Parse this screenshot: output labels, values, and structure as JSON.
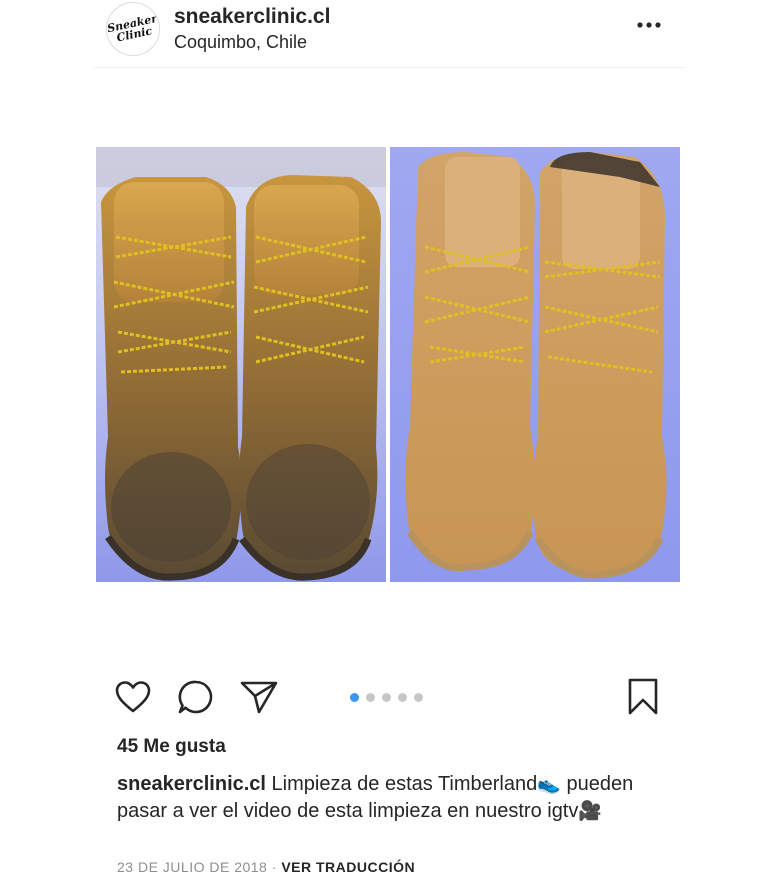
{
  "header": {
    "avatar_text_line1": "Sneaker",
    "avatar_text_line2": "Clinic",
    "username": "sneakerclinic.cl",
    "location": "Coquimbo, Chile",
    "more_icon": "more-horizontal-icon"
  },
  "post": {
    "photo_left_alt": "Timberland boots before cleaning",
    "photo_right_alt": "Timberland boots after cleaning",
    "carousel": {
      "count": 5,
      "active_index": 0
    }
  },
  "actions": {
    "like_icon": "heart-icon",
    "comment_icon": "comment-icon",
    "share_icon": "send-icon",
    "save_icon": "bookmark-icon"
  },
  "likes_text": "45 Me gusta",
  "caption": {
    "username": "sneakerclinic.cl",
    "text_part1": "Limpieza de estas Timberland",
    "emoji1": "👟",
    "text_part2": "pueden pasar a ver el video de esta limpieza en nuestro igtv",
    "emoji2": "🎥"
  },
  "meta": {
    "date": "23 DE JULIO DE 2018",
    "separator": " · ",
    "translate_label": "VER TRADUCCIÓN"
  },
  "colors": {
    "accent_dot": "#3897f0",
    "text": "#262626",
    "muted": "#8e8e8e"
  }
}
